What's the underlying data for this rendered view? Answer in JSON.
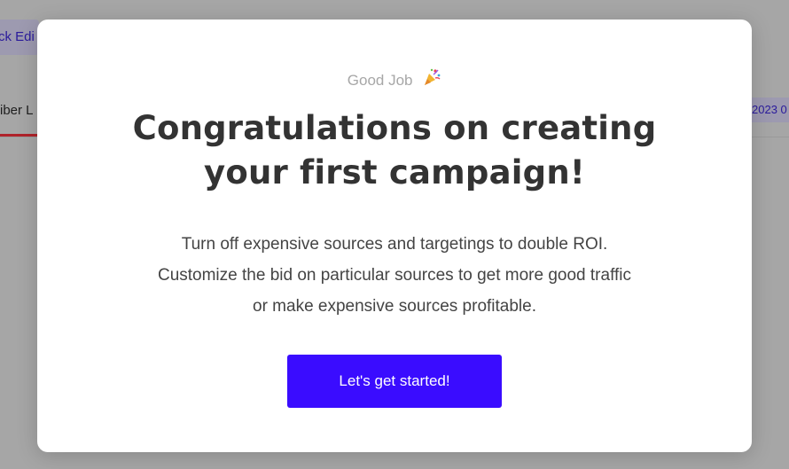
{
  "background": {
    "quick_edit_label": "ck Edi",
    "tab_label": "iber L",
    "date_label": "2023 0"
  },
  "modal": {
    "eyebrow": "Good Job",
    "eyebrow_icon": "party-popper-icon",
    "headline_line1": "Congratulations on creating",
    "headline_line2": "your first campaign!",
    "body_lines": [
      "Turn off expensive sources and targetings to double ROI.",
      "Customize the bid on particular sources to get more good traffic",
      "or make expensive sources profitable."
    ],
    "cta_label": "Let's get started!"
  },
  "colors": {
    "accent": "#3a0cff",
    "overlay": "#a6a6a6",
    "headline": "#333333"
  }
}
